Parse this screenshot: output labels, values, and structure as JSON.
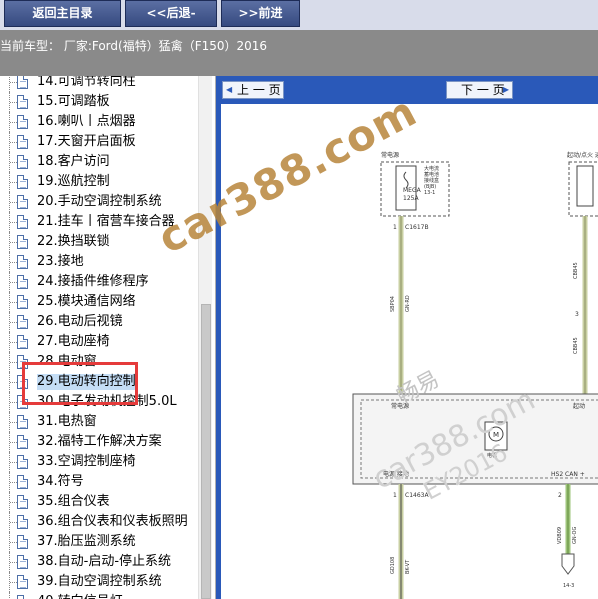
{
  "toolbar": {
    "home_label": "返回主目录",
    "back_label": "<<后退-",
    "forward_label": ">>前进"
  },
  "model_bar": {
    "text": "当前车型： 厂家:Ford(福特）猛禽（F150）2016"
  },
  "tree": {
    "items": [
      {
        "label": "14.可调节转向柱"
      },
      {
        "label": "15.可调踏板"
      },
      {
        "label": "16.喇叭丨点烟器"
      },
      {
        "label": "17.天窗开启面板"
      },
      {
        "label": "18.客户访问"
      },
      {
        "label": "19.巡航控制"
      },
      {
        "label": "20.手动空调控制系统"
      },
      {
        "label": "21.挂车丨宿营车接合器"
      },
      {
        "label": "22.换挡联锁"
      },
      {
        "label": "23.接地"
      },
      {
        "label": "24.接插件维修程序"
      },
      {
        "label": "25.模块通信网络"
      },
      {
        "label": "26.电动后视镜"
      },
      {
        "label": "27.电动座椅"
      },
      {
        "label": "28.电动窗"
      },
      {
        "label": "29.电动转向控制",
        "selected": true
      },
      {
        "label": "30.电子发动机控制5.0L"
      },
      {
        "label": "31.电热窗"
      },
      {
        "label": "32.福特工作解决方案"
      },
      {
        "label": "33.空调控制座椅"
      },
      {
        "label": "34.符号"
      },
      {
        "label": "35.组合仪表"
      },
      {
        "label": "36.组合仪表和仪表板照明"
      },
      {
        "label": "37.胎压监测系统"
      },
      {
        "label": "38.自动-启动-停止系统"
      },
      {
        "label": "39.自动空调控制系统"
      },
      {
        "label": "40.转向信号灯"
      }
    ]
  },
  "viewer": {
    "prev_label": "上 一 页",
    "next_label": "下 一 页"
  },
  "diagram": {
    "label_power_left": "常电源",
    "label_power_right": "起动/点火 运行",
    "fuse_name": "MEGA",
    "fuse_rating": "125A",
    "battery_junction": "大电流\n蓄电池\n接线盒\n(BJB)\n13-1",
    "conn_top": "C1617B",
    "wire_left_code": "SBP04",
    "wire_left_color": "GN-RD",
    "wire_right_code1": "CBB45",
    "wire_right_code2": "CBB45",
    "wire_right_color": "GN-RD",
    "module_power": "常电源",
    "module_power2": "起动",
    "module_ground": "电源 接地",
    "module_can": "HS2 CAN +",
    "motor_label": "电机",
    "conn_bottom_left": "C1463A",
    "wire_gd_code": "GD108",
    "wire_gd_color": "BK-VT",
    "wire_can_code": "VDB09",
    "wire_can_color": "GN-OG",
    "pin_1_top": "1",
    "pin_3_right": "3",
    "pin_1_bottom": "1",
    "pin_2_bottom": "2",
    "page_ref": "14-3"
  },
  "watermark": {
    "brand": "car388.com",
    "sub": "畅易",
    "url": "car388.com",
    "year": "EY2016"
  },
  "colors": {
    "toolbar_button": "#4a5e94",
    "viewer_bar": "#2a59b9",
    "highlight": "#e53b3b",
    "watermark": "#b8863b"
  }
}
